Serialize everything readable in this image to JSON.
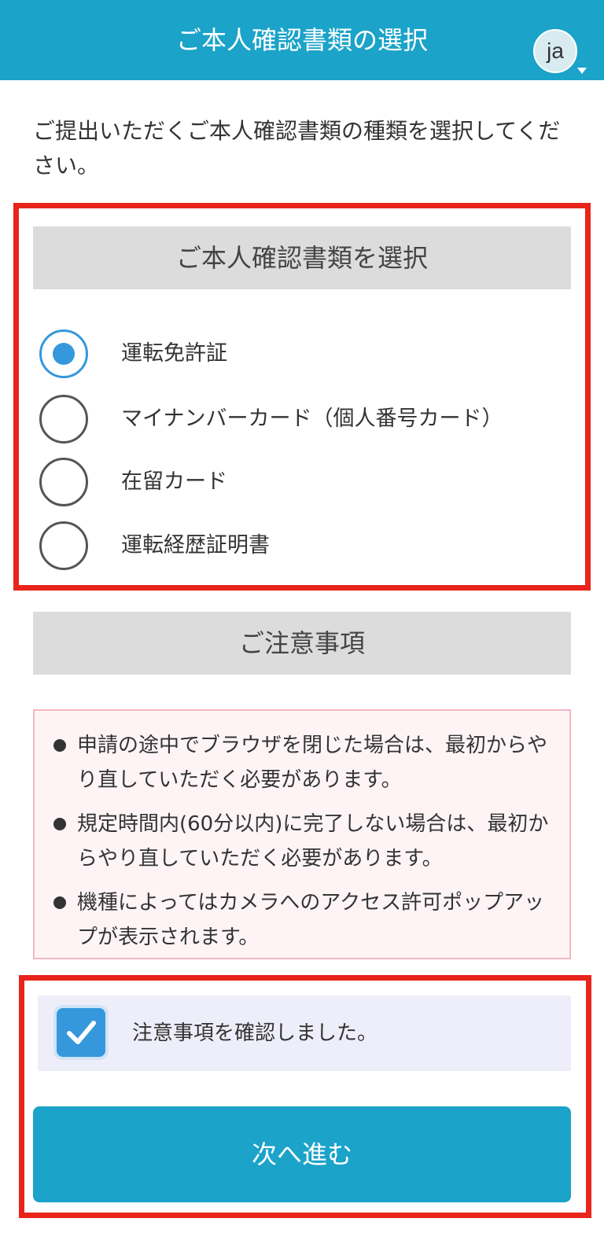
{
  "header": {
    "title": "ご本人確認書類の選択",
    "lang": "ja"
  },
  "intro": "ご提出いただくご本人確認書類の種類を選択してください。",
  "select_section": {
    "heading": "ご本人確認書類を選択",
    "options": [
      {
        "label": "運転免許証",
        "selected": true
      },
      {
        "label": "マイナンバーカード（個人番号カード）",
        "selected": false
      },
      {
        "label": "在留カード",
        "selected": false
      },
      {
        "label": "運転経歴証明書",
        "selected": false
      }
    ]
  },
  "notes_section": {
    "heading": "ご注意事項",
    "items": [
      "申請の途中でブラウザを閉じた場合は、最初からやり直していただく必要があります。",
      "規定時間内(60分以内)に完了しない場合は、最初からやり直していただく必要があります。",
      "機種によってはカメラへのアクセス許可ポップアップが表示されます。"
    ]
  },
  "confirm": {
    "label": "注意事項を確認しました。",
    "checked": true
  },
  "next_button": {
    "label": "次へ進む"
  },
  "colors": {
    "header": "#1ba3c9",
    "accent": "#3598dc",
    "highlight": "#e8241b",
    "notes_bg": "#fef4f6"
  }
}
